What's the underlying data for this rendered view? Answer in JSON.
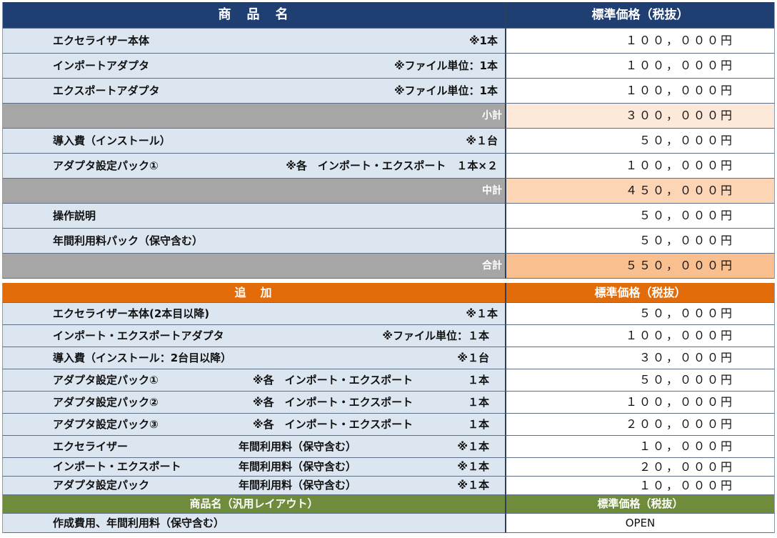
{
  "header_main": {
    "name": "商　品　名",
    "price": "標準価格（税抜）"
  },
  "main_items": [
    {
      "name": "エクセライザー本体",
      "note": "※1本",
      "price": "１００，０００円"
    },
    {
      "name": "インポートアダプタ",
      "note": "※ファイル単位：1本",
      "price": "１００，０００円"
    },
    {
      "name": "エクスポートアダプタ",
      "note": "※ファイル単位：1本",
      "price": "１００，０００円"
    }
  ],
  "subtotal1": {
    "label": "小計",
    "price": "３００，０００円"
  },
  "main_items2": [
    {
      "name": "導入費（インストール）",
      "note": "※１台",
      "price": "５０，０００円"
    },
    {
      "name": "アダプタ設定パック①",
      "note": "※各　インポート・エクスポート　１本×２",
      "price": "１００，０００円"
    }
  ],
  "subtotal2": {
    "label": "中計",
    "price": "４５０，０００円"
  },
  "main_items3": [
    {
      "name": "操作説明",
      "price": "５０，０００円"
    },
    {
      "name": "年間利用料パック（保守含む）",
      "price": "５０，０００円"
    }
  ],
  "total": {
    "label": "合計",
    "price": "５５０，０００円"
  },
  "header_add": {
    "name": "追　加",
    "price": "標準価格（税抜）"
  },
  "add_items": [
    {
      "name": "エクセライザー本体(2本目以降)",
      "mid": "",
      "note": "※１本",
      "price": "５０，０００円"
    },
    {
      "name": "インポート・エクスポートアダプタ",
      "mid": "",
      "note": "※ファイル単位：１本",
      "price": "１００，０００円"
    },
    {
      "name": "導入費（インストール：2台目以降）",
      "mid": "",
      "note": "※１台",
      "price": "３０，０００円"
    },
    {
      "name": "アダプタ設定パック①",
      "mid": "※各　インポート・エクスポート",
      "note": "１本",
      "price": "５０，０００円"
    },
    {
      "name": "アダプタ設定パック②",
      "mid": "※各　インポート・エクスポート",
      "note": "１本",
      "price": "１００，０００円"
    },
    {
      "name": "アダプタ設定パック③",
      "mid": "※各　インポート・エクスポート",
      "note": "１本",
      "price": "２００，０００円"
    },
    {
      "name": "エクセライザー",
      "mid": "年間利用料（保守含む）",
      "note": "※１本",
      "price": "１０，０００円"
    },
    {
      "name": "インポート・エクスポート",
      "mid": "年間利用料（保守含む）",
      "note": "※１本",
      "price": "２０，０００円"
    },
    {
      "name": "アダプタ設定パック",
      "mid": "年間利用料（保守含む）",
      "note": "※１本",
      "price": "１０，０００円"
    }
  ],
  "header_generic": {
    "name": "商品名（汎用レイアウト）",
    "price": "標準価格（税抜）"
  },
  "generic_item": {
    "name": "作成費用、年間利用料（保守含む）",
    "price": "OPEN"
  }
}
